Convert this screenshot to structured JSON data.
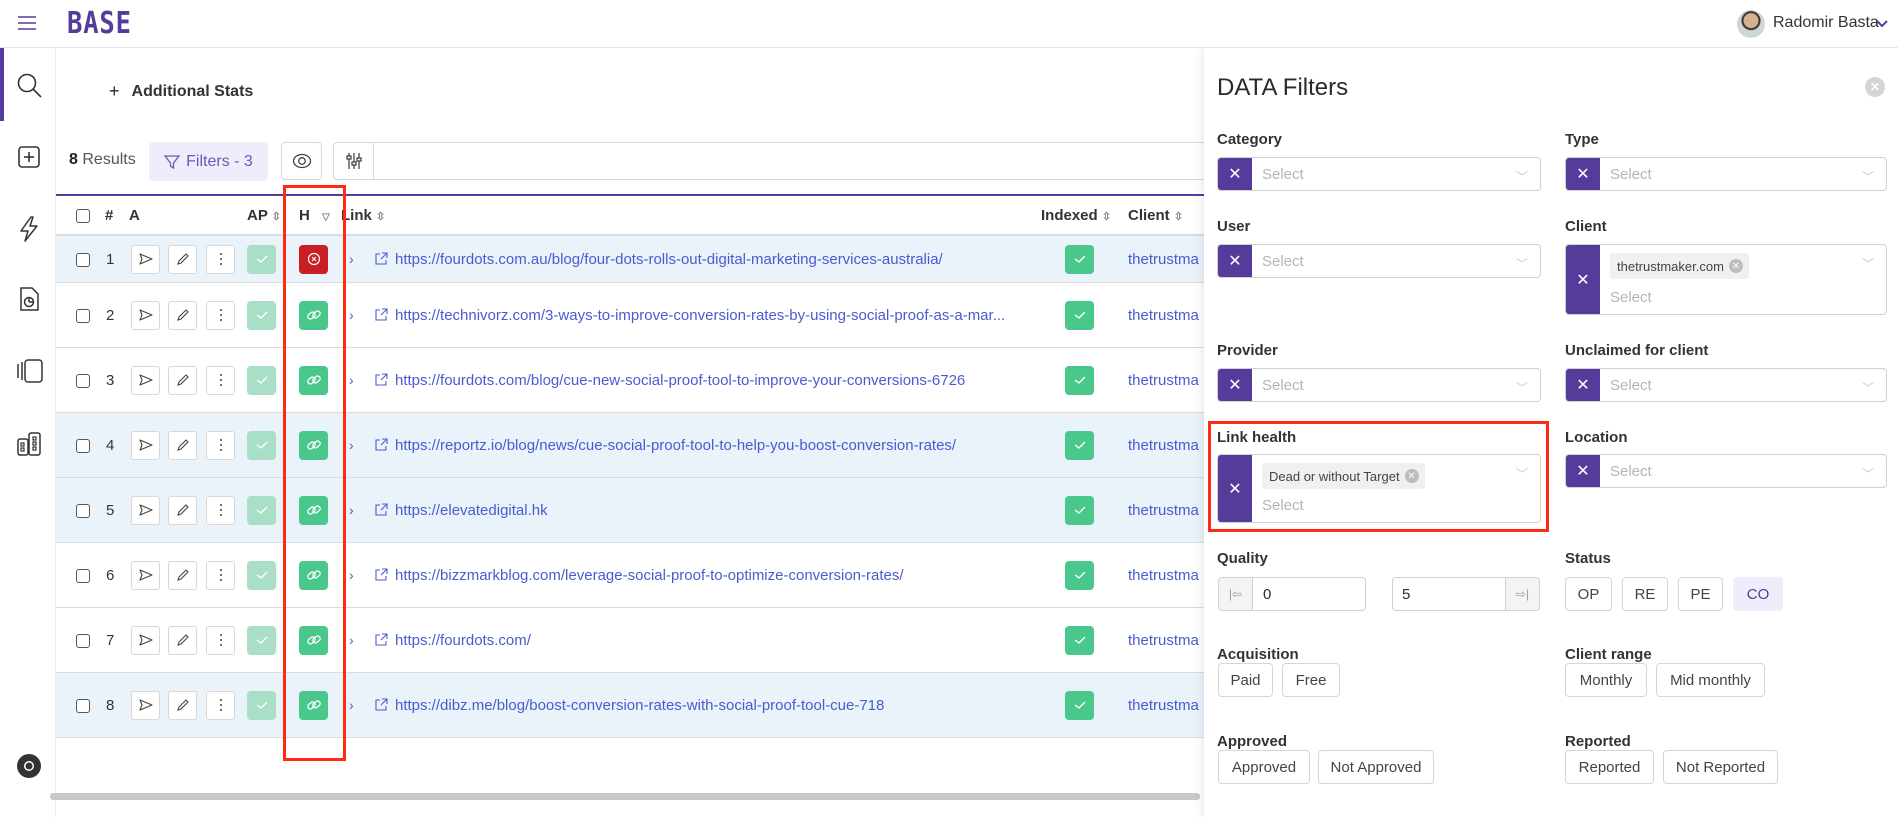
{
  "header": {
    "logo": "BASE",
    "user_name": "Radomir Basta",
    "menu_icon": "hamburger-icon"
  },
  "sidebar": {
    "items": [
      {
        "icon": "search-icon",
        "active": true
      },
      {
        "icon": "plus-square-icon"
      },
      {
        "icon": "bolt-icon"
      },
      {
        "icon": "report-file-icon"
      },
      {
        "icon": "cards-icon"
      },
      {
        "icon": "buildings-icon"
      },
      {
        "icon": "chrome-icon"
      }
    ]
  },
  "main": {
    "additional_stats": "Additional Stats",
    "results_count": "8",
    "results_label": "Results",
    "filters_label": "Filters - 3",
    "search_value": ""
  },
  "table": {
    "columns": [
      "#",
      "A",
      "AP",
      "H",
      "Link",
      "Indexed",
      "Client"
    ],
    "rows": [
      {
        "n": "1",
        "health": "dead",
        "link": "https://fourdots.com.au/blog/four-dots-rolls-out-digital-marketing-services-australia/",
        "client": "thetrustma",
        "highlight": true
      },
      {
        "n": "2",
        "health": "ok",
        "link": "https://technivorz.com/3-ways-to-improve-conversion-rates-by-using-social-proof-as-a-mar...",
        "client": "thetrustma",
        "highlight": false
      },
      {
        "n": "3",
        "health": "ok",
        "link": "https://fourdots.com/blog/cue-new-social-proof-tool-to-improve-your-conversions-6726",
        "client": "thetrustma",
        "highlight": false
      },
      {
        "n": "4",
        "health": "ok",
        "link": "https://reportz.io/blog/news/cue-social-proof-tool-to-help-you-boost-conversion-rates/",
        "client": "thetrustma",
        "highlight": true
      },
      {
        "n": "5",
        "health": "ok",
        "link": "https://elevatedigital.hk",
        "client": "thetrustma",
        "highlight": true
      },
      {
        "n": "6",
        "health": "ok",
        "link": "https://bizzmarkblog.com/leverage-social-proof-to-optimize-conversion-rates/",
        "client": "thetrustma",
        "highlight": false
      },
      {
        "n": "7",
        "health": "ok",
        "link": "https://fourdots.com/",
        "client": "thetrustma",
        "highlight": false
      },
      {
        "n": "8",
        "health": "ok",
        "link": "https://dibz.me/blog/boost-conversion-rates-with-social-proof-tool-cue-718",
        "client": "thetrustma",
        "highlight": true
      }
    ]
  },
  "filters": {
    "title": "DATA Filters",
    "placeholder": "Select",
    "category": "Category",
    "type": "Type",
    "user": "User",
    "client": "Client",
    "client_tag": "thetrustmaker.com",
    "provider": "Provider",
    "unclaimed": "Unclaimed for client",
    "link_health": "Link health",
    "link_health_tag": "Dead or without Target",
    "location": "Location",
    "quality": "Quality",
    "quality_min": "0",
    "quality_max": "5",
    "status": "Status",
    "status_options": [
      "OP",
      "RE",
      "PE",
      "CO"
    ],
    "status_active": "CO",
    "acquisition": "Acquisition",
    "acquisition_options": [
      "Paid",
      "Free"
    ],
    "client_range": "Client range",
    "client_range_options": [
      "Monthly",
      "Mid monthly"
    ],
    "approved": "Approved",
    "approved_options": [
      "Approved",
      "Not Approved"
    ],
    "reported": "Reported",
    "reported_options": [
      "Reported",
      "Not Reported"
    ]
  },
  "colors": {
    "accent": "#553c9a",
    "green": "#4ac78b",
    "green_light": "#a9dfc7",
    "red": "#c81e24",
    "link": "#4a5bd0",
    "annotation": "#ff2a12"
  }
}
